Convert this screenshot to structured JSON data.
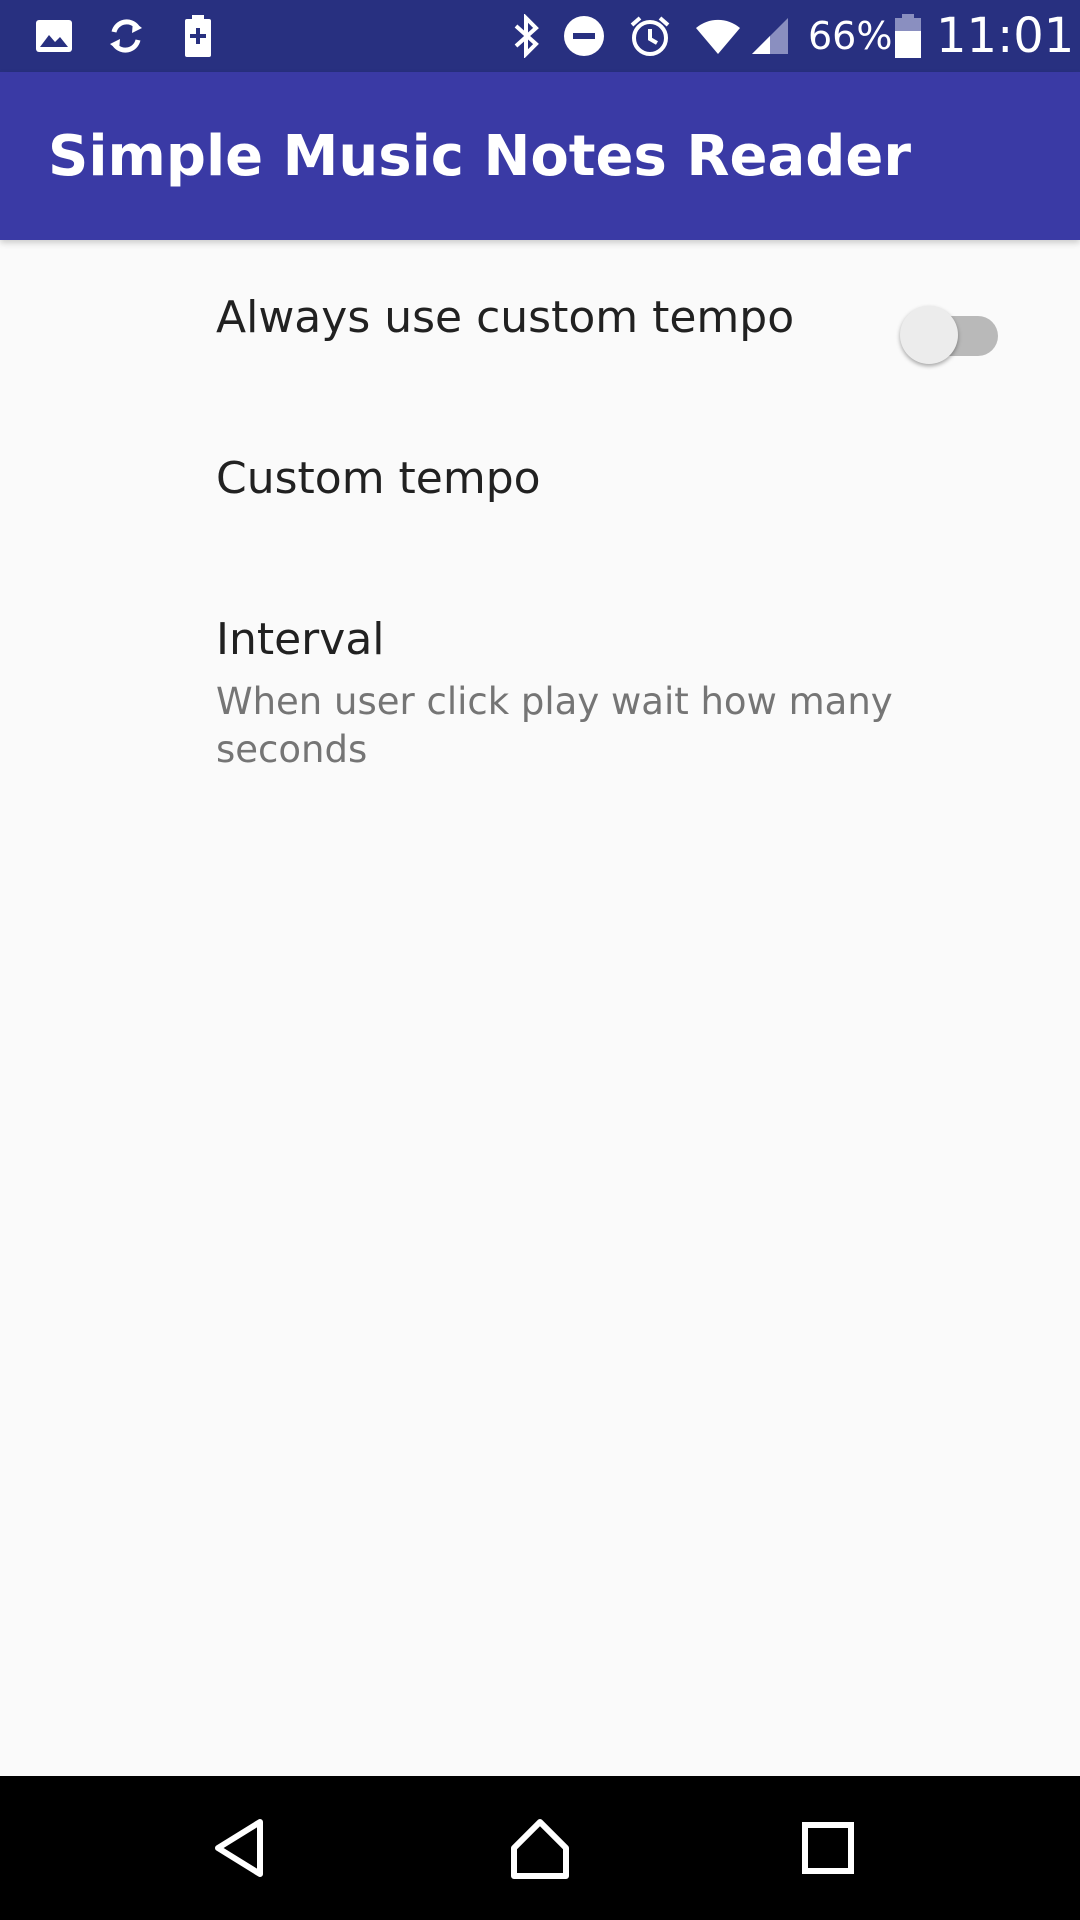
{
  "status_bar": {
    "battery_percent": "66%",
    "time": "11:01",
    "left_icons": [
      "gallery-icon",
      "sync-icon",
      "battery-saver-icon"
    ],
    "right_icons": [
      "bluetooth-icon",
      "do-not-disturb-icon",
      "alarm-icon",
      "wifi-icon",
      "cell-signal-icon",
      "battery-icon"
    ]
  },
  "app_bar": {
    "title": "Simple Music Notes Reader",
    "color": "#3a3aa5"
  },
  "preferences": [
    {
      "title": "Always use custom tempo",
      "widget": "switch",
      "checked": false
    },
    {
      "title": "Custom tempo"
    },
    {
      "title": "Interval",
      "summary": "When user click play wait how many seconds"
    }
  ],
  "nav_bar": {
    "buttons": [
      "back-icon",
      "home-icon",
      "recents-icon"
    ]
  }
}
